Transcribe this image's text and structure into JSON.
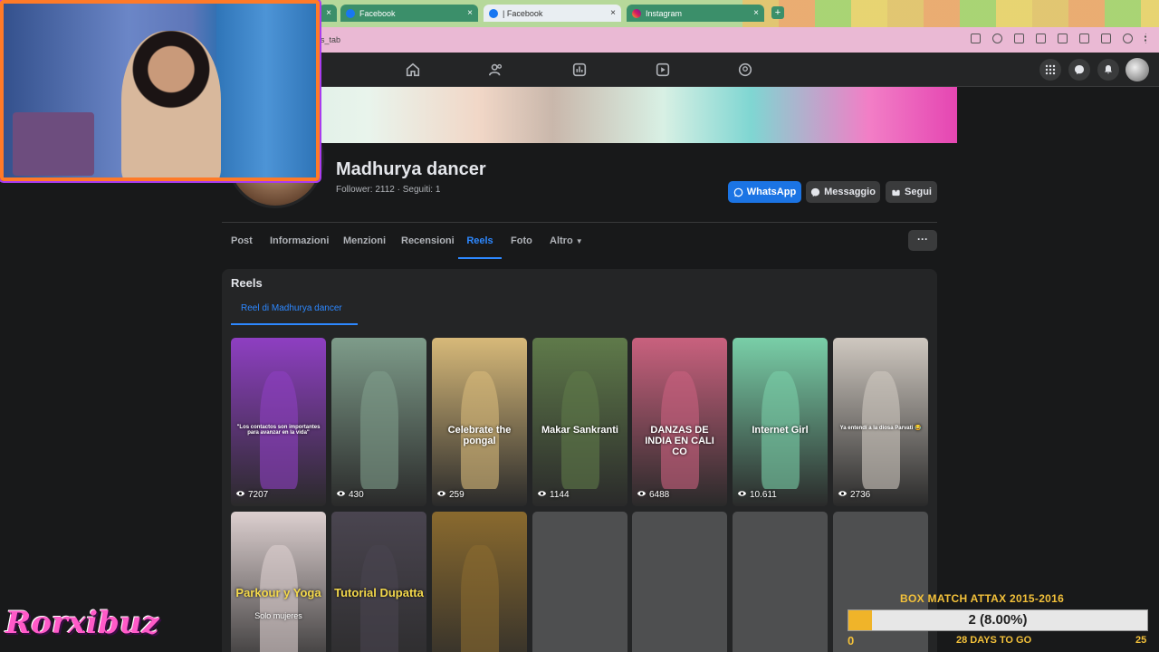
{
  "browser": {
    "tabs": [
      {
        "title": "Facebook"
      },
      {
        "title": "| Facebook"
      },
      {
        "title": "Instagram"
      }
    ],
    "new_tab": "+",
    "url_fragment": "ls_tab"
  },
  "profile": {
    "name": "Madhurya dancer",
    "stats": "Follower: 2112 · Seguiti: 1",
    "buttons": {
      "whatsapp": "WhatsApp",
      "message": "Messaggio",
      "follow": "Segui"
    }
  },
  "profile_tabs": [
    "Post",
    "Informazioni",
    "Menzioni",
    "Recensioni",
    "Reels",
    "Foto",
    "Altro"
  ],
  "active_tab": "Reels",
  "more_label": "···",
  "reels_section": {
    "title": "Reels",
    "subtab": "Reel di Madhurya dancer",
    "row1": [
      {
        "views": "7207",
        "caption": "\"Los contactos son importantes para avanzar en la vida\"",
        "color": "#8e3fc2"
      },
      {
        "views": "430",
        "caption": "",
        "color": "#7e9c8a"
      },
      {
        "views": "259",
        "caption": "Celebrate the pongal",
        "color": "#d7b979"
      },
      {
        "views": "1144",
        "caption": "Makar Sankranti",
        "color": "#5f7a4a"
      },
      {
        "views": "6488",
        "caption": "DANZAS DE INDIA EN CALI CO",
        "color": "#c9617e"
      },
      {
        "views": "10.611",
        "caption": "Internet Girl",
        "color": "#79cfa8"
      },
      {
        "views": "2736",
        "caption": "Ya entendí a la diosa Parvati 😂",
        "color": "#cfc8c0"
      }
    ],
    "row2": [
      {
        "caption": "Parkour y Yoga",
        "sub": "Solo mujeres",
        "color": "#dccfcf"
      },
      {
        "caption": "Tutorial Dupatta",
        "sub": "",
        "color": "#4a4550"
      },
      {
        "caption": "",
        "sub": "",
        "color": "#8a6a2e"
      }
    ]
  },
  "overlay": {
    "brand": "Rorxibuz",
    "box_title": "BOX MATCH ATTAX 2015-2016",
    "progress_text": "2 (8.00%)",
    "progress_fraction": 0.08,
    "min": "0",
    "days": "28 DAYS TO GO",
    "max": "25"
  },
  "colors": {
    "accent": "#2d88ff",
    "whatsapp_btn": "#1b74e4",
    "progress_fill": "#f0b429",
    "overlay_text": "#f3c13a"
  }
}
